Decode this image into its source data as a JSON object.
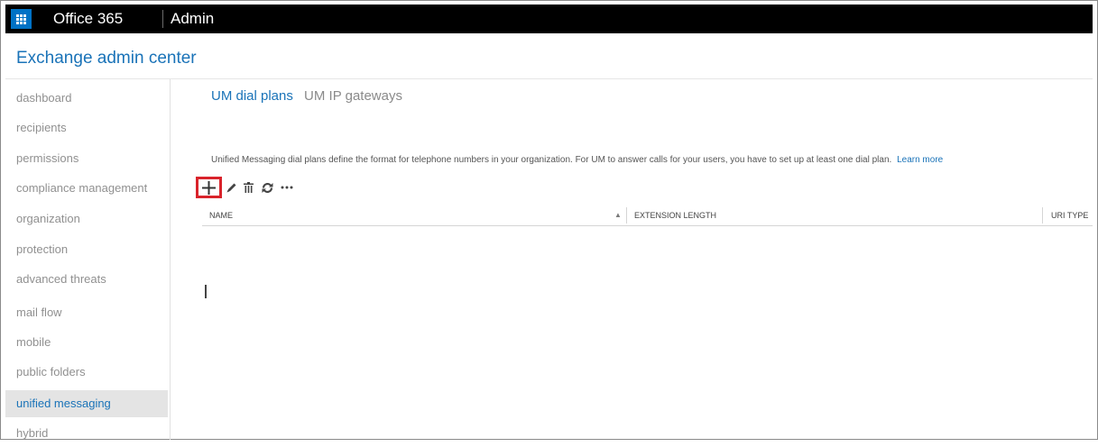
{
  "topbar": {
    "app_launcher_icon": "waffle-grid-icon",
    "brand": "Office 365",
    "product": "Admin"
  },
  "header": {
    "title": "Exchange admin center"
  },
  "sidebar": {
    "items": [
      {
        "label": "dashboard"
      },
      {
        "label": "recipients"
      },
      {
        "label": "permissions"
      },
      {
        "label": "compliance management"
      },
      {
        "label": "organization"
      },
      {
        "label": "protection"
      },
      {
        "label": "advanced threats"
      },
      {
        "label": "mail flow"
      },
      {
        "label": "mobile"
      },
      {
        "label": "public folders"
      },
      {
        "label": "unified messaging",
        "active": true
      },
      {
        "label": "hybrid"
      }
    ]
  },
  "main": {
    "tabs": [
      {
        "label": "UM dial plans",
        "active": true
      },
      {
        "label": "UM IP gateways",
        "active": false
      }
    ],
    "description": "Unified Messaging dial plans define the format for telephone numbers in your organization. For UM to answer calls for your users, you have to set up at least one dial plan.",
    "learn_more": "Learn more",
    "toolbar": {
      "icons": [
        "add-icon",
        "edit-icon",
        "delete-icon",
        "refresh-icon",
        "more-icon"
      ]
    },
    "grid": {
      "columns": [
        "NAME",
        "EXTENSION LENGTH",
        "URI TYPE"
      ],
      "sort_column": "NAME",
      "sort_direction": "ascending",
      "rows": []
    }
  },
  "colors": {
    "accent": "#1a73b8",
    "topbar_bg": "#000000",
    "launcher_bg": "#0072c6",
    "highlight_border": "#d9232b",
    "active_nav_bg": "#e4e4e4"
  }
}
